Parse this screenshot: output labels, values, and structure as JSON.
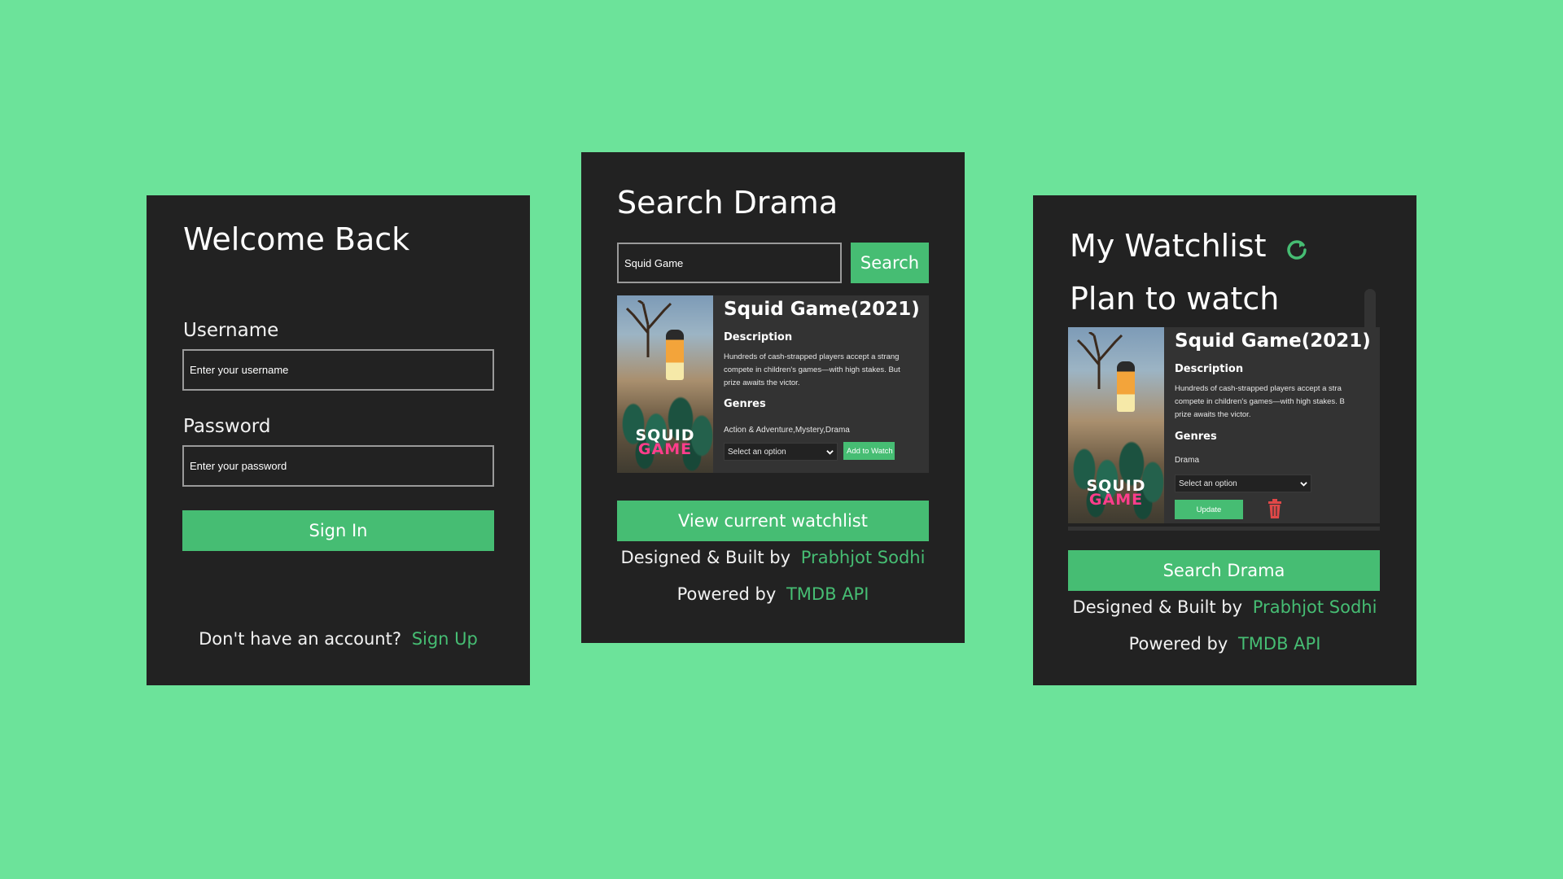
{
  "login": {
    "title": "Welcome Back",
    "username_label": "Username",
    "username_placeholder": "Enter your username",
    "password_label": "Password",
    "password_placeholder": "Enter your password",
    "signin_label": "Sign In",
    "no_account_text": "Don't have an account?",
    "signup_link": "Sign Up"
  },
  "search": {
    "title": "Search Drama",
    "query_value": "Squid Game",
    "search_button": "Search",
    "result": {
      "title": "Squid Game(2021)",
      "description_label": "Description",
      "description_lines": [
        "Hundreds of cash-strapped players accept a strang",
        "compete in children's games—with high stakes. But",
        "prize awaits the victor."
      ],
      "genres_label": "Genres",
      "genres": "Action & Adventure,Mystery,Drama",
      "select_value": "Select an option",
      "add_button": "Add to Watch",
      "poster_logo_line1": "SQUID",
      "poster_logo_line2": "GAME"
    },
    "view_watchlist_button": "View current watchlist",
    "credit_text": "Designed & Built by",
    "credit_name": "Prabhjot Sodhi",
    "powered_text": "Powered by",
    "powered_name": "TMDB API"
  },
  "watchlist": {
    "title": "My Watchlist",
    "section_title": "Plan to watch",
    "item": {
      "title": "Squid Game(2021)",
      "description_label": "Description",
      "description_lines": [
        "Hundreds of cash-strapped players accept a stra",
        "compete in children's games—with high stakes. B",
        "prize awaits the victor."
      ],
      "genres_label": "Genres",
      "genres": "Drama",
      "select_value": "Select an option",
      "update_button": "Update",
      "poster_logo_line1": "SQUID",
      "poster_logo_line2": "GAME"
    },
    "search_button": "Search Drama",
    "credit_text": "Designed & Built by",
    "credit_name": "Prabhjot Sodhi",
    "powered_text": "Powered by",
    "powered_name": "TMDB API"
  },
  "icons": {
    "refresh": "refresh-icon",
    "trash": "trash-icon",
    "chevron": "chevron-down-icon"
  },
  "colors": {
    "background": "#6ce39a",
    "panel": "#222222",
    "card": "#333333",
    "accent": "#46bd73",
    "danger": "#e04848"
  }
}
